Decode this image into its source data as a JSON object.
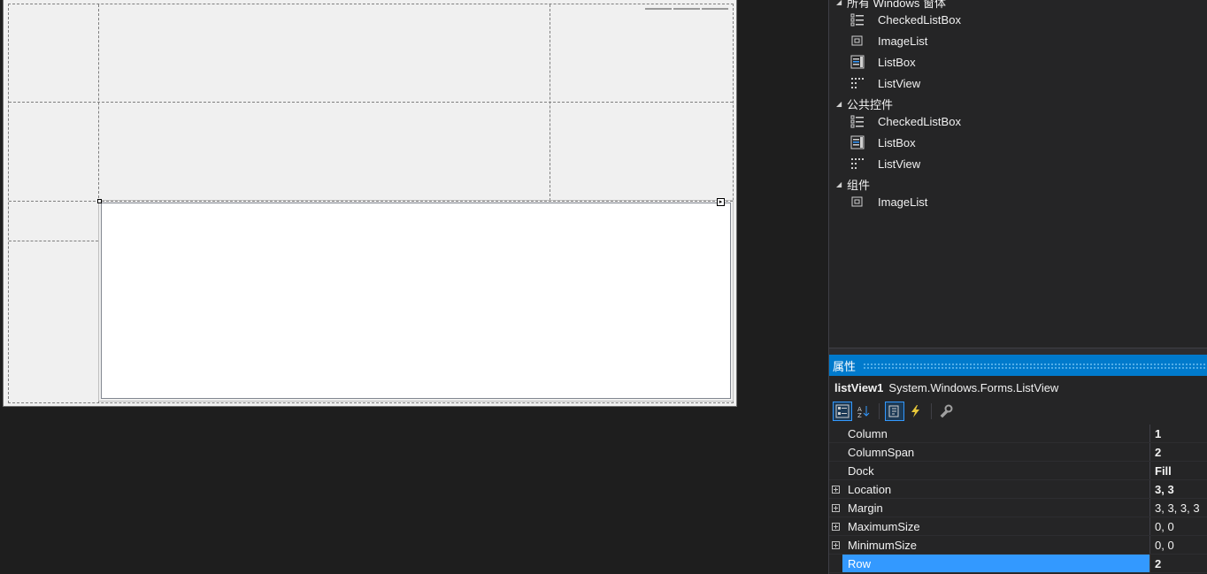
{
  "toolbox": {
    "groups": [
      {
        "label": "所有 Windows 窗体",
        "items": [
          {
            "label": "CheckedListBox",
            "icon": "checkedlistbox-icon"
          },
          {
            "label": "ImageList",
            "icon": "imagelist-icon"
          },
          {
            "label": "ListBox",
            "icon": "listbox-icon"
          },
          {
            "label": "ListView",
            "icon": "listview-icon"
          }
        ]
      },
      {
        "label": "公共控件",
        "items": [
          {
            "label": "CheckedListBox",
            "icon": "checkedlistbox-icon"
          },
          {
            "label": "ListBox",
            "icon": "listbox-icon"
          },
          {
            "label": "ListView",
            "icon": "listview-icon"
          }
        ]
      },
      {
        "label": "组件",
        "items": [
          {
            "label": "ImageList",
            "icon": "imagelist-icon"
          }
        ]
      }
    ]
  },
  "properties": {
    "title": "属性",
    "object_name": "listView1",
    "object_type": "System.Windows.Forms.ListView",
    "toolbar": [
      "categorized-icon",
      "alphabetical-icon",
      "properties-icon",
      "events-icon",
      "property-pages-icon"
    ],
    "rows": [
      {
        "name": "Column",
        "value": "1",
        "bold": true,
        "expandable": false
      },
      {
        "name": "ColumnSpan",
        "value": "2",
        "bold": true,
        "expandable": false
      },
      {
        "name": "Dock",
        "value": "Fill",
        "bold": true,
        "expandable": false
      },
      {
        "name": "Location",
        "value": "3, 3",
        "bold": true,
        "expandable": true
      },
      {
        "name": "Margin",
        "value": "3, 3, 3, 3",
        "bold": false,
        "expandable": true
      },
      {
        "name": "MaximumSize",
        "value": "0, 0",
        "bold": false,
        "expandable": true
      },
      {
        "name": "MinimumSize",
        "value": "0, 0",
        "bold": false,
        "expandable": true
      },
      {
        "name": "Row",
        "value": "2",
        "bold": true,
        "expandable": false,
        "selected": true
      }
    ]
  },
  "colors": {
    "accent": "#007acc",
    "selection": "#3399ff",
    "background": "#1e1e1e",
    "panel": "#252526",
    "form_surface": "#f0f0f0"
  }
}
